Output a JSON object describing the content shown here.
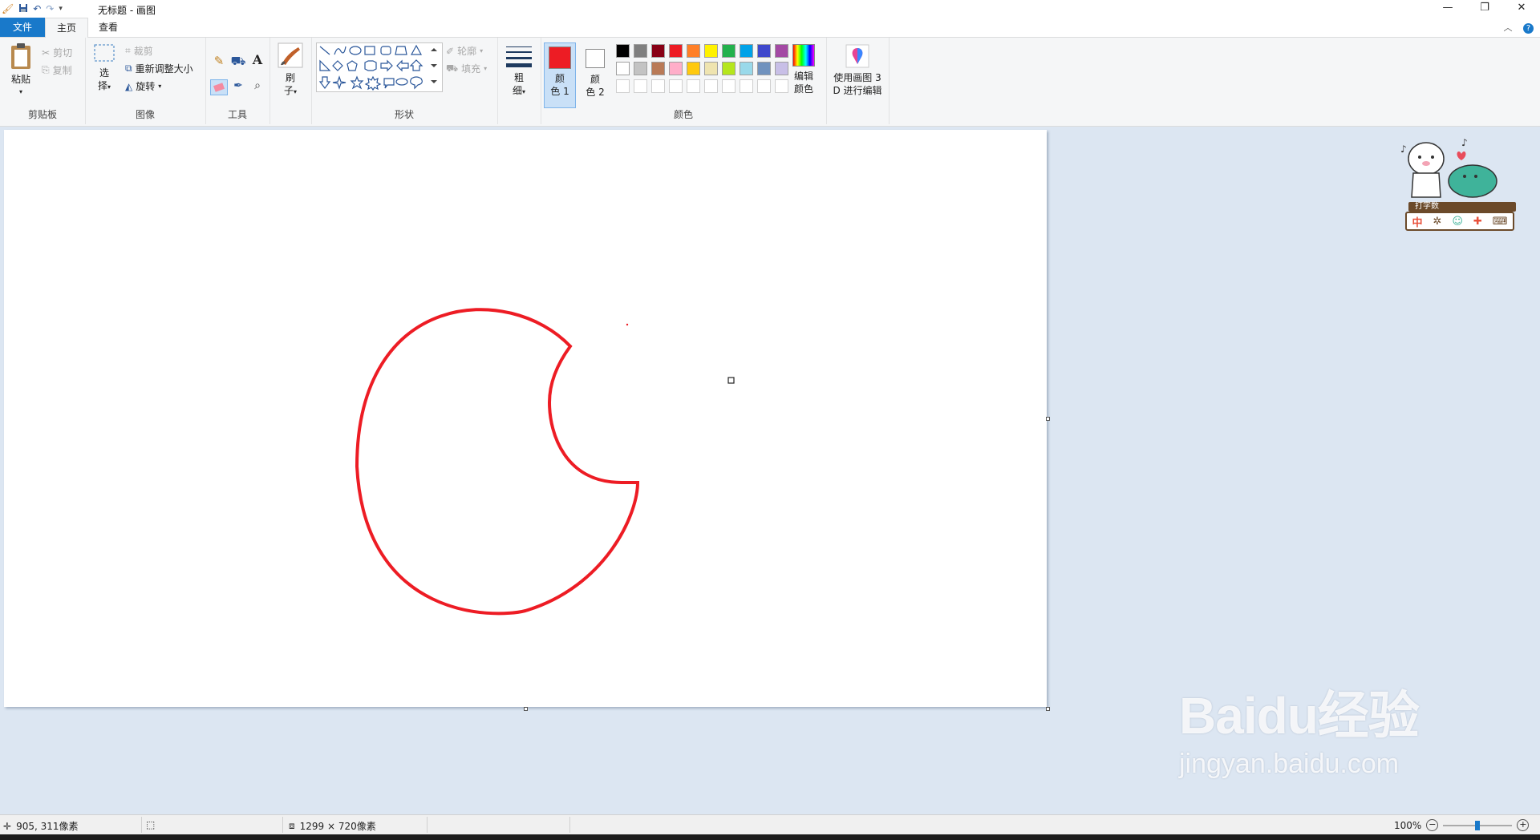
{
  "titlebar": {
    "title": "无标题 - 画图",
    "minimize": "—",
    "restore": "❐",
    "close": "✕"
  },
  "tabs": {
    "file": "文件",
    "home": "主页",
    "view": "查看"
  },
  "clipboard": {
    "paste": "粘贴",
    "cut": "剪切",
    "copy": "复制",
    "label": "剪贴板"
  },
  "image": {
    "select_top": "选",
    "select_bottom": "择",
    "crop": "裁剪",
    "resize": "重新调整大小",
    "rotate": "旋转",
    "label": "图像"
  },
  "tools": {
    "label": "工具"
  },
  "brushes": {
    "top": "刷",
    "bottom": "子"
  },
  "shapes": {
    "outline": "轮廓",
    "fill": "填充",
    "label": "形状"
  },
  "size": {
    "top": "粗",
    "bottom": "细"
  },
  "colors": {
    "color1_top": "颜",
    "color1_bottom": "色 1",
    "color2_top": "颜",
    "color2_bottom": "色 2",
    "edit_top": "编辑",
    "edit_bottom": "颜色",
    "label": "颜色",
    "color1_value": "#ed1c24",
    "color2_value": "#ffffff",
    "palette_row1": [
      "#000000",
      "#7f7f7f",
      "#880015",
      "#ed1c24",
      "#ff7f27",
      "#fff200",
      "#22b14c",
      "#00a2e8",
      "#3f48cc",
      "#a349a4"
    ],
    "palette_row2": [
      "#ffffff",
      "#c3c3c3",
      "#b97a57",
      "#ffaec9",
      "#ffc90e",
      "#efe4b0",
      "#b5e61d",
      "#99d9ea",
      "#7092be",
      "#c8bfe7"
    ],
    "palette_row3": [
      "#ffffff",
      "#ffffff",
      "#ffffff",
      "#ffffff",
      "#ffffff",
      "#ffffff",
      "#ffffff",
      "#ffffff",
      "#ffffff",
      "#ffffff"
    ]
  },
  "paint3d": {
    "line1": "使用画图 3",
    "line2": "D 进行编辑"
  },
  "overlay": {
    "ime_label": "打字数",
    "ime_mode": "中"
  },
  "status": {
    "cursor_pos": "905, 311像素",
    "canvas_size": "1299 × 720像素",
    "zoom": "100%",
    "zoom_level": 0.5
  },
  "watermark": {
    "big": "Baidu经验",
    "small": "jingyan.baidu.com"
  }
}
